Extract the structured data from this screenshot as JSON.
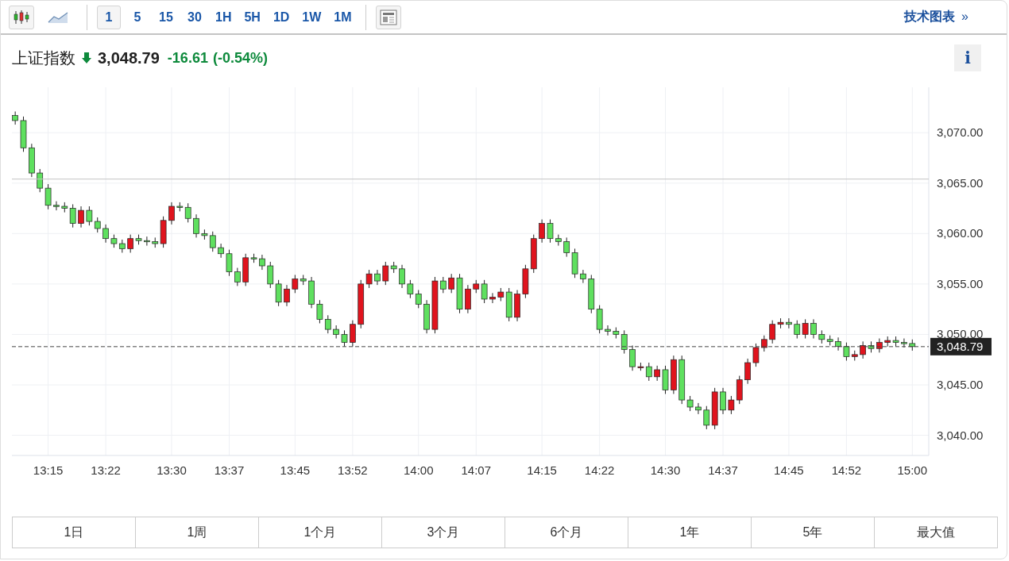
{
  "toolbar": {
    "chart_types": [
      {
        "kind": "candles",
        "selected": true
      },
      {
        "kind": "area",
        "selected": false
      }
    ],
    "intervals": [
      {
        "label": "1",
        "selected": true
      },
      {
        "label": "5",
        "selected": false
      },
      {
        "label": "15",
        "selected": false
      },
      {
        "label": "30",
        "selected": false
      },
      {
        "label": "1H",
        "selected": false
      },
      {
        "label": "5H",
        "selected": false
      },
      {
        "label": "1D",
        "selected": false
      },
      {
        "label": "1W",
        "selected": false
      },
      {
        "label": "1M",
        "selected": false
      }
    ],
    "link": "技术图表",
    "link_arrow": "»"
  },
  "quote": {
    "name": "上证指数",
    "price": "3,048.79",
    "change": "-16.61",
    "change_pct": "(-0.54%)",
    "falling": true,
    "info": "i"
  },
  "chart": {
    "chart_data": {
      "type": "candlestick",
      "grid": true,
      "ref_lines": [
        {
          "axis": "y",
          "value": 3065.4
        },
        {
          "axis": "y",
          "value": 3048.79,
          "label": "3,048.79"
        }
      ],
      "x": [
        791,
        792,
        793,
        794,
        795,
        796,
        797,
        798,
        799,
        800,
        801,
        802,
        803,
        804,
        805,
        806,
        807,
        808,
        809,
        810,
        811,
        812,
        813,
        814,
        815,
        816,
        817,
        818,
        819,
        820,
        821,
        822,
        823,
        824,
        825,
        826,
        827,
        828,
        829,
        830,
        831,
        832,
        833,
        834,
        835,
        836,
        837,
        838,
        839,
        840,
        841,
        842,
        843,
        844,
        845,
        846,
        847,
        848,
        849,
        850,
        851,
        852,
        853,
        854,
        855,
        856,
        857,
        858,
        859,
        860,
        861,
        862,
        863,
        864,
        865,
        866,
        867,
        868,
        869,
        870,
        871,
        872,
        873,
        874,
        875,
        876,
        877,
        878,
        879,
        880,
        881,
        882,
        883,
        884,
        885,
        886,
        887,
        888,
        889,
        890,
        891,
        892,
        893,
        894,
        895,
        896,
        897,
        898,
        899,
        900
      ],
      "xlim": [
        790.6,
        902
      ],
      "ohlc": [
        [
          3071.7,
          3072.1,
          3070.8,
          3071.2
        ],
        [
          3071.2,
          3071.6,
          3068.1,
          3068.5
        ],
        [
          3068.5,
          3068.9,
          3065.6,
          3066
        ],
        [
          3066,
          3066.4,
          3064.1,
          3064.5
        ],
        [
          3064.5,
          3064.9,
          3062.4,
          3062.8
        ],
        [
          3062.8,
          3063.2,
          3062.3,
          3062.7
        ],
        [
          3062.7,
          3063.1,
          3062.1,
          3062.5
        ],
        [
          3062.5,
          3062.9,
          3060.6,
          3061
        ],
        [
          3061,
          3062.7,
          3060.6,
          3062.3
        ],
        [
          3062.3,
          3062.7,
          3060.8,
          3061.2
        ],
        [
          3061.2,
          3061.6,
          3060.1,
          3060.5
        ],
        [
          3060.5,
          3060.9,
          3059.1,
          3059.5
        ],
        [
          3059.5,
          3059.9,
          3058.6,
          3059
        ],
        [
          3059,
          3059.4,
          3058.1,
          3058.5
        ],
        [
          3058.5,
          3059.9,
          3058.1,
          3059.5
        ],
        [
          3059.5,
          3059.9,
          3058.9,
          3059.3
        ],
        [
          3059.3,
          3059.7,
          3058.8,
          3059.2
        ],
        [
          3059.2,
          3059.6,
          3058.6,
          3059
        ],
        [
          3059,
          3061.7,
          3058.6,
          3061.3
        ],
        [
          3061.3,
          3063.1,
          3060.9,
          3062.7
        ],
        [
          3062.7,
          3063.1,
          3062.2,
          3062.6
        ],
        [
          3062.6,
          3063,
          3061.1,
          3061.5
        ],
        [
          3061.5,
          3061.9,
          3059.6,
          3060
        ],
        [
          3060,
          3060.4,
          3059.4,
          3059.8
        ],
        [
          3059.8,
          3060.2,
          3058.2,
          3058.6
        ],
        [
          3058.6,
          3059,
          3057.6,
          3058
        ],
        [
          3058,
          3058.4,
          3055.8,
          3056.2
        ],
        [
          3056.2,
          3056.6,
          3054.8,
          3055.2
        ],
        [
          3055.2,
          3058,
          3054.8,
          3057.6
        ],
        [
          3057.6,
          3058,
          3057.1,
          3057.5
        ],
        [
          3057.5,
          3057.9,
          3056.4,
          3056.8
        ],
        [
          3056.8,
          3057.2,
          3054.6,
          3055
        ],
        [
          3055,
          3055.4,
          3052.8,
          3053.2
        ],
        [
          3053.2,
          3054.9,
          3052.8,
          3054.5
        ],
        [
          3054.5,
          3055.9,
          3054.1,
          3055.5
        ],
        [
          3055.5,
          3055.9,
          3054.9,
          3055.3
        ],
        [
          3055.3,
          3055.7,
          3052.6,
          3053
        ],
        [
          3053,
          3053.4,
          3051.1,
          3051.5
        ],
        [
          3051.5,
          3051.9,
          3050.1,
          3050.5
        ],
        [
          3050.5,
          3050.9,
          3049.6,
          3050
        ],
        [
          3050,
          3050.4,
          3048.8,
          3049.2
        ],
        [
          3049.2,
          3051.4,
          3048.8,
          3051
        ],
        [
          3051,
          3055.4,
          3050.6,
          3055
        ],
        [
          3055,
          3056.4,
          3054.6,
          3056
        ],
        [
          3056,
          3056.4,
          3054.9,
          3055.3
        ],
        [
          3055.3,
          3057.2,
          3054.9,
          3056.8
        ],
        [
          3056.8,
          3057.2,
          3056.1,
          3056.5
        ],
        [
          3056.5,
          3056.9,
          3054.6,
          3055
        ],
        [
          3055,
          3055.4,
          3053.6,
          3054
        ],
        [
          3054,
          3054.4,
          3052.6,
          3053
        ],
        [
          3053,
          3053.4,
          3050.1,
          3050.5
        ],
        [
          3050.5,
          3055.7,
          3050.1,
          3055.3
        ],
        [
          3055.3,
          3055.7,
          3054.1,
          3054.5
        ],
        [
          3054.5,
          3056,
          3054.1,
          3055.6
        ],
        [
          3055.6,
          3056,
          3052.1,
          3052.5
        ],
        [
          3052.5,
          3054.9,
          3052.1,
          3054.5
        ],
        [
          3054.5,
          3055.4,
          3054.1,
          3055
        ],
        [
          3055,
          3055.4,
          3053.1,
          3053.5
        ],
        [
          3053.5,
          3054.1,
          3053.1,
          3053.7
        ],
        [
          3053.7,
          3054.6,
          3053.3,
          3054.2
        ],
        [
          3054.2,
          3054.6,
          3051.3,
          3051.7
        ],
        [
          3051.7,
          3054.4,
          3051.3,
          3054
        ],
        [
          3054,
          3056.9,
          3053.6,
          3056.5
        ],
        [
          3056.5,
          3059.9,
          3056.1,
          3059.5
        ],
        [
          3059.5,
          3061.4,
          3059.1,
          3061
        ],
        [
          3061,
          3061.4,
          3059.1,
          3059.5
        ],
        [
          3059.5,
          3059.9,
          3058.8,
          3059.2
        ],
        [
          3059.2,
          3059.6,
          3057.7,
          3058.1
        ],
        [
          3058.1,
          3058.5,
          3055.6,
          3056
        ],
        [
          3056,
          3056.4,
          3055.1,
          3055.5
        ],
        [
          3055.5,
          3055.9,
          3052.1,
          3052.5
        ],
        [
          3052.5,
          3052.9,
          3050.1,
          3050.5
        ],
        [
          3050.5,
          3050.9,
          3049.9,
          3050.3
        ],
        [
          3050.3,
          3050.7,
          3049.6,
          3050
        ],
        [
          3050,
          3050.4,
          3048.1,
          3048.5
        ],
        [
          3048.5,
          3048.9,
          3046.4,
          3046.8
        ],
        [
          3046.8,
          3047.2,
          3046.4,
          3046.8
        ],
        [
          3046.8,
          3047.2,
          3045.4,
          3045.8
        ],
        [
          3045.8,
          3046.9,
          3045.4,
          3046.5
        ],
        [
          3046.5,
          3046.9,
          3044.1,
          3044.5
        ],
        [
          3044.5,
          3047.9,
          3044.1,
          3047.5
        ],
        [
          3047.5,
          3047.9,
          3043.1,
          3043.5
        ],
        [
          3043.5,
          3043.9,
          3042.4,
          3042.8
        ],
        [
          3042.8,
          3043.2,
          3042.1,
          3042.5
        ],
        [
          3042.5,
          3042.9,
          3040.6,
          3041
        ],
        [
          3041,
          3044.7,
          3040.6,
          3044.3
        ],
        [
          3044.3,
          3044.7,
          3042.1,
          3042.5
        ],
        [
          3042.5,
          3043.9,
          3042.1,
          3043.5
        ],
        [
          3043.5,
          3045.9,
          3043.1,
          3045.5
        ],
        [
          3045.5,
          3047.6,
          3045.1,
          3047.2
        ],
        [
          3047.2,
          3049.1,
          3046.8,
          3048.7
        ],
        [
          3048.7,
          3049.9,
          3048.3,
          3049.5
        ],
        [
          3049.5,
          3051.4,
          3049.1,
          3051
        ],
        [
          3051,
          3051.6,
          3050.6,
          3051.2
        ],
        [
          3051.2,
          3051.6,
          3050.6,
          3051
        ],
        [
          3051,
          3051.4,
          3049.6,
          3050
        ],
        [
          3050,
          3051.5,
          3049.6,
          3051.1
        ],
        [
          3051.1,
          3051.5,
          3049.6,
          3050
        ],
        [
          3050,
          3050.4,
          3049.1,
          3049.5
        ],
        [
          3049.5,
          3049.9,
          3048.9,
          3049.3
        ],
        [
          3049.3,
          3049.7,
          3048.4,
          3048.8
        ],
        [
          3048.8,
          3049.2,
          3047.4,
          3047.8
        ],
        [
          3047.8,
          3048.4,
          3047.4,
          3048
        ],
        [
          3048,
          3049.3,
          3047.6,
          3048.9
        ],
        [
          3048.9,
          3049.3,
          3048.2,
          3048.6
        ],
        [
          3048.6,
          3049.6,
          3048.2,
          3049.2
        ],
        [
          3049.2,
          3049.8,
          3048.8,
          3049.4
        ],
        [
          3049.4,
          3049.8,
          3048.8,
          3049.2
        ],
        [
          3049.2,
          3049.6,
          3048.7,
          3049.1
        ],
        [
          3049.1,
          3049.5,
          3048.39,
          3048.79
        ]
      ],
      "ylim": [
        3038,
        3074.5
      ],
      "yticks": [
        {
          "value": 3070,
          "label": "3,070.00"
        },
        {
          "value": 3065,
          "label": "3,065.00"
        },
        {
          "value": 3060,
          "label": "3,060.00"
        },
        {
          "value": 3055,
          "label": "3,055.00"
        },
        {
          "value": 3050,
          "label": "3,050.00"
        },
        {
          "value": 3045,
          "label": "3,045.00"
        },
        {
          "value": 3040,
          "label": "3,040.00"
        }
      ],
      "xticks": [
        {
          "value": 795,
          "label": "13:15"
        },
        {
          "value": 802,
          "label": "13:22"
        },
        {
          "value": 810,
          "label": "13:30"
        },
        {
          "value": 817,
          "label": "13:37"
        },
        {
          "value": 825,
          "label": "13:45"
        },
        {
          "value": 832,
          "label": "13:52"
        },
        {
          "value": 840,
          "label": "14:00"
        },
        {
          "value": 847,
          "label": "14:07"
        },
        {
          "value": 855,
          "label": "14:15"
        },
        {
          "value": 862,
          "label": "14:22"
        },
        {
          "value": 870,
          "label": "14:30"
        },
        {
          "value": 877,
          "label": "14:37"
        },
        {
          "value": 885,
          "label": "14:45"
        },
        {
          "value": 892,
          "label": "14:52"
        },
        {
          "value": 900,
          "label": "15:00"
        }
      ]
    }
  },
  "ranges": [
    "1日",
    "1周",
    "1个月",
    "3个月",
    "6个月",
    "1年",
    "5年",
    "最大值"
  ]
}
